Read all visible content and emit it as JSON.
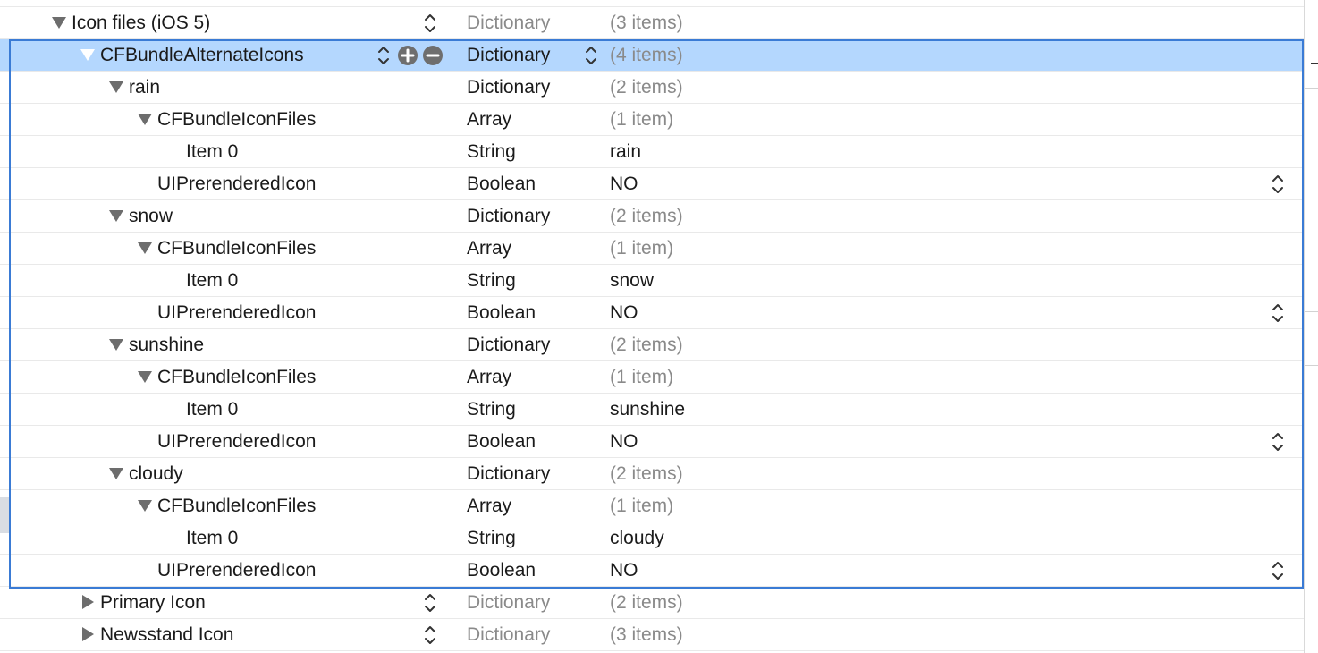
{
  "rows": [
    {
      "key": "Icon files (iOS 5)",
      "type": "Dictionary",
      "value": "(3 items)"
    },
    {
      "key": "CFBundleAlternateIcons",
      "type": "Dictionary",
      "value": "(4 items)"
    },
    {
      "key": "rain",
      "type": "Dictionary",
      "value": "(2 items)"
    },
    {
      "key": "CFBundleIconFiles",
      "type": "Array",
      "value": "(1 item)"
    },
    {
      "key": "Item 0",
      "type": "String",
      "value": "rain"
    },
    {
      "key": "UIPrerenderedIcon",
      "type": "Boolean",
      "value": "NO"
    },
    {
      "key": "snow",
      "type": "Dictionary",
      "value": "(2 items)"
    },
    {
      "key": "CFBundleIconFiles",
      "type": "Array",
      "value": "(1 item)"
    },
    {
      "key": "Item 0",
      "type": "String",
      "value": "snow"
    },
    {
      "key": "UIPrerenderedIcon",
      "type": "Boolean",
      "value": "NO"
    },
    {
      "key": "sunshine",
      "type": "Dictionary",
      "value": "(2 items)"
    },
    {
      "key": "CFBundleIconFiles",
      "type": "Array",
      "value": "(1 item)"
    },
    {
      "key": "Item 0",
      "type": "String",
      "value": "sunshine"
    },
    {
      "key": "UIPrerenderedIcon",
      "type": "Boolean",
      "value": "NO"
    },
    {
      "key": "cloudy",
      "type": "Dictionary",
      "value": "(2 items)"
    },
    {
      "key": "CFBundleIconFiles",
      "type": "Array",
      "value": "(1 item)"
    },
    {
      "key": "Item 0",
      "type": "String",
      "value": "cloudy"
    },
    {
      "key": "UIPrerenderedIcon",
      "type": "Boolean",
      "value": "NO"
    },
    {
      "key": "Primary Icon",
      "type": "Dictionary",
      "value": "(2 items)"
    },
    {
      "key": "Newsstand Icon",
      "type": "Dictionary",
      "value": "(3 items)"
    }
  ],
  "icons": {
    "disclosure_open": "disclosure-triangle-open-icon",
    "disclosure_closed": "disclosure-triangle-closed-icon",
    "stepper": "up-down-stepper-icon",
    "add": "add-row-icon",
    "remove": "remove-row-icon"
  },
  "colors": {
    "selection": "#b4d7fe",
    "outline": "#3a7bd5",
    "dim_text": "#8a8a8a"
  }
}
